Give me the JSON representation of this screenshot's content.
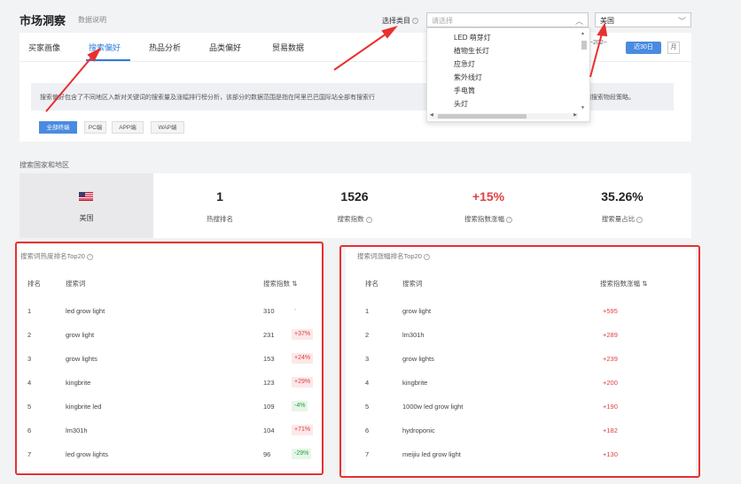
{
  "header": {
    "title": "市场洞察",
    "subtitle": "数据说明",
    "category_label": "选择类目",
    "category_placeholder": "请选择",
    "country_value": "美国"
  },
  "tabs": [
    {
      "label": "买家画像"
    },
    {
      "label": "搜索偏好"
    },
    {
      "label": "热品分析"
    },
    {
      "label": "品类偏好"
    },
    {
      "label": "贸易数据"
    }
  ],
  "date": {
    "range_text": "~202~",
    "btn_30": "近30日",
    "btn_month": "月"
  },
  "info": {
    "text": "搜索偏好包含了不同地区入新对关键词的搜索量及涨幅排行榜分析，该部分的数据范围是指在阿里巴巴国际站全部有搜索行",
    "text_tail": "词搜索物段策略。"
  },
  "filters": [
    "全部终端",
    "PC端",
    "APP端",
    "WAP端"
  ],
  "dropdown": {
    "items": [
      "LED 萌芽灯",
      "植物生长灯",
      "应急灯",
      "紫外线灯",
      "手电筒",
      "头灯"
    ]
  },
  "section_label": "搜索国家和地区",
  "stats": {
    "country": "美国",
    "items": [
      {
        "value": "1",
        "label": "热搜排名"
      },
      {
        "value": "1526",
        "label": "搜索指数"
      },
      {
        "value": "+15%",
        "label": "搜索指数涨幅"
      },
      {
        "value": "35.26%",
        "label": "搜索量占比"
      }
    ]
  },
  "hot_panel": {
    "title": "搜索词热度排名Top20",
    "headers": [
      "排名",
      "搜索词",
      "搜索指数"
    ],
    "rows": [
      {
        "rank": "1",
        "term": "led grow light",
        "index": "310",
        "change": "-",
        "dir": "none"
      },
      {
        "rank": "2",
        "term": "grow light",
        "index": "231",
        "change": "+37%",
        "dir": "up"
      },
      {
        "rank": "3",
        "term": "grow lights",
        "index": "153",
        "change": "+24%",
        "dir": "up"
      },
      {
        "rank": "4",
        "term": "kingbrite",
        "index": "123",
        "change": "+29%",
        "dir": "up"
      },
      {
        "rank": "5",
        "term": "kingbrite led",
        "index": "109",
        "change": "-4%",
        "dir": "down"
      },
      {
        "rank": "6",
        "term": "lm301h",
        "index": "104",
        "change": "+71%",
        "dir": "up"
      },
      {
        "rank": "7",
        "term": "led grow lights",
        "index": "96",
        "change": "-29%",
        "dir": "down"
      }
    ]
  },
  "growth_panel": {
    "title": "搜索词涨幅排名Top20",
    "headers": [
      "排名",
      "搜索词",
      "搜索指数涨幅"
    ],
    "rows": [
      {
        "rank": "1",
        "term": "grow light",
        "growth": "+595"
      },
      {
        "rank": "2",
        "term": "lm301h",
        "growth": "+289"
      },
      {
        "rank": "3",
        "term": "grow lights",
        "growth": "+239"
      },
      {
        "rank": "4",
        "term": "kingbrite",
        "growth": "+200"
      },
      {
        "rank": "5",
        "term": "1000w led grow light",
        "growth": "+190"
      },
      {
        "rank": "6",
        "term": "hydroponic",
        "growth": "+182"
      },
      {
        "rank": "7",
        "term": "meijiu led grow light",
        "growth": "+130"
      }
    ]
  },
  "colors": {
    "accent": "#2f7bd9",
    "annotation_red": "#e83030",
    "up": "#e04040",
    "down": "#2ea040"
  }
}
